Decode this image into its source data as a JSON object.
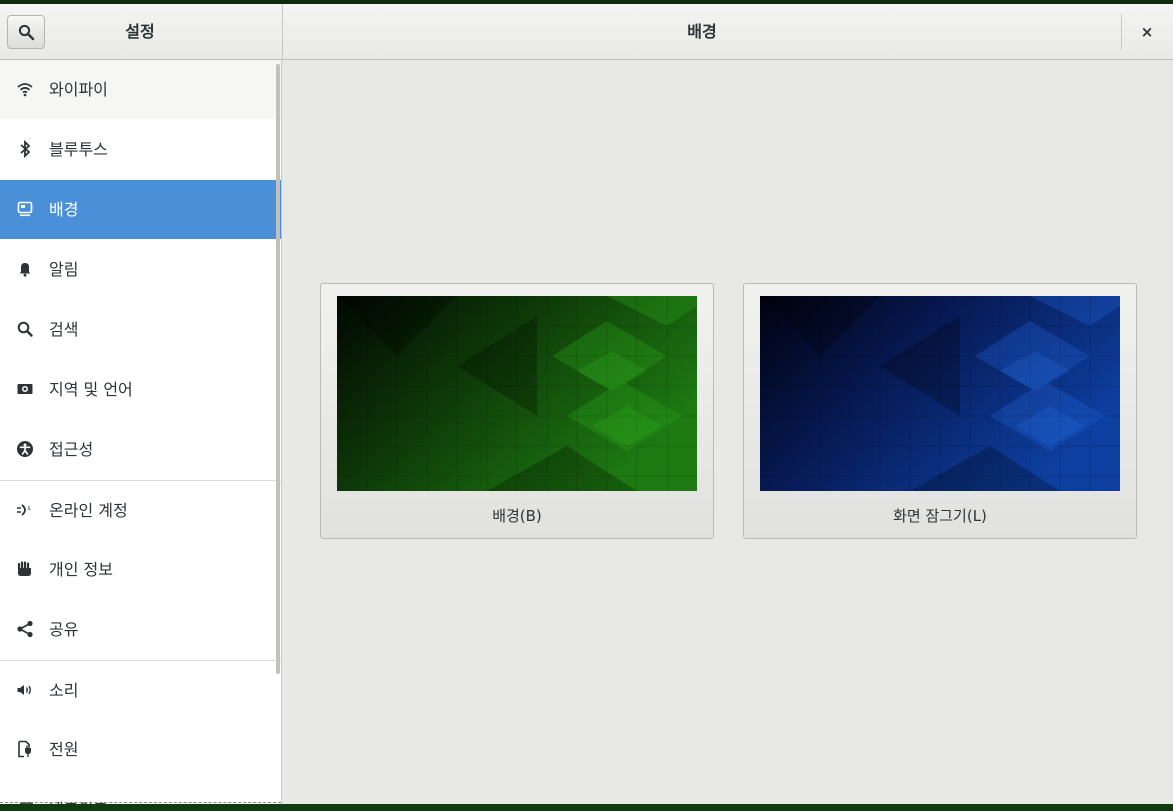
{
  "header": {
    "sidebar_title": "설정",
    "page_title": "배경",
    "close_label": "×"
  },
  "sidebar": {
    "items": [
      {
        "label": "와이파이",
        "icon": "wifi-icon"
      },
      {
        "label": "블루투스",
        "icon": "bluetooth-icon"
      },
      {
        "label": "배경",
        "icon": "background-icon",
        "active": true
      },
      {
        "label": "알림",
        "icon": "bell-icon"
      },
      {
        "label": "검색",
        "icon": "search-icon"
      },
      {
        "label": "지역 및 언어",
        "icon": "region-icon"
      },
      {
        "label": "접근성",
        "icon": "accessibility-icon"
      },
      {
        "label": "온라인 계정",
        "icon": "online-accounts-icon"
      },
      {
        "label": "개인 정보",
        "icon": "privacy-hand-icon"
      },
      {
        "label": "공유",
        "icon": "share-icon"
      },
      {
        "label": "소리",
        "icon": "speaker-icon"
      },
      {
        "label": "전원",
        "icon": "power-icon"
      },
      {
        "label": "네트워크",
        "icon": "network-icon"
      }
    ]
  },
  "main": {
    "background_card": {
      "caption": "배경(B)",
      "accent": "#1e7a10"
    },
    "lockscreen_card": {
      "caption": "화면 잠그기(L)",
      "accent": "#0d3fa0"
    }
  },
  "colors": {
    "selection": "#4a90d9",
    "window_bg": "#e8e8e7"
  }
}
